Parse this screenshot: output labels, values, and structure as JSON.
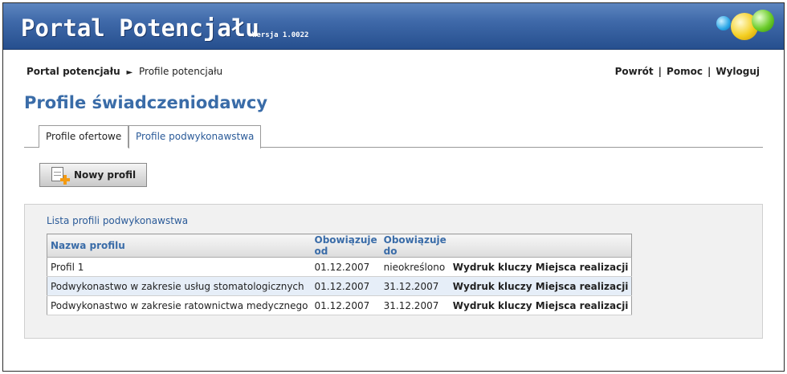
{
  "header": {
    "title": "Portal Potencjału",
    "version": "Wersja 1.0022"
  },
  "breadcrumb": {
    "root": "Portal potencjału",
    "separator": "►",
    "current": "Profile potencjału"
  },
  "toplinks": {
    "back": "Powrót",
    "help": "Pomoc",
    "logout": "Wyloguj",
    "pipe": "|"
  },
  "page_title": "Profile świadczeniodawcy",
  "tabs": [
    {
      "label": "Profile ofertowe",
      "active": false
    },
    {
      "label": "Profile podwykonawstwa",
      "active": true
    }
  ],
  "new_button": {
    "label": "Nowy profil",
    "icon": "add-document-icon"
  },
  "list": {
    "title": "Lista profili podwykonawstwa",
    "columns": [
      "Nazwa profilu",
      "Obowiązuje od",
      "Obowiązuje do",
      ""
    ],
    "rows": [
      {
        "name": "Profil 1",
        "from": "01.12.2007",
        "to": "nieokreślono",
        "action1": "Wydruk kluczy",
        "action2": "Miejsca realizacji"
      },
      {
        "name": "Podwykonastwo w zakresie usług stomatologicznych",
        "from": "01.12.2007",
        "to": "31.12.2007",
        "action1": "Wydruk kluczy",
        "action2": "Miejsca realizacji"
      },
      {
        "name": "Podwykonastwo w zakresie ratownictwa medycznego",
        "from": "01.12.2007",
        "to": "31.12.2007",
        "action1": "Wydruk kluczy",
        "action2": "Miejsca realizacji"
      }
    ]
  },
  "colors": {
    "accent": "#3a6ca8",
    "header_top": "#5d86c0",
    "header_bottom": "#264f8e",
    "row_alt": "#e6eef8"
  }
}
